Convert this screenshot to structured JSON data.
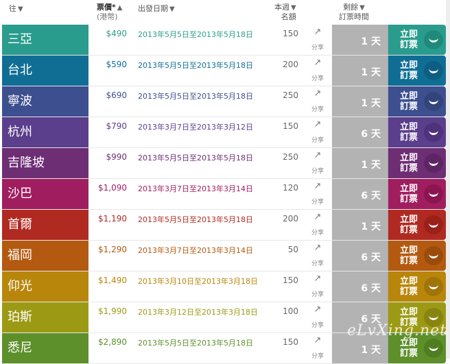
{
  "header": {
    "destination": "往",
    "price_line1": "票價*",
    "price_line2": "(港幣)",
    "date": "出發日期",
    "quota_line1": "本週",
    "quota_line2": "名額",
    "remain_line1": "剩餘",
    "remain_line2": "訂票時間",
    "sort_down": "▼",
    "sort_up": "▲"
  },
  "share_label": "分享",
  "share_icon": "↗",
  "book_label": "立即\n訂票",
  "watermark": "eLvXing.net",
  "rows": [
    {
      "dest": "三亞",
      "price": "$490",
      "date": "2013年5月5日至2013年5月18日",
      "quota": "150",
      "remain": "1 天",
      "color": "#2a9c8d",
      "btn": "#1f8a7a",
      "text_color": "#2a9c8d"
    },
    {
      "dest": "台北",
      "price": "$590",
      "date": "2013年5月5日至2013年5月18日",
      "quota": "200",
      "remain": "1 天",
      "color": "#106e95",
      "btn": "#0c5e82",
      "text_color": "#106e95"
    },
    {
      "dest": "寧波",
      "price": "$690",
      "date": "2013年5月5日至2013年5月18日",
      "quota": "250",
      "remain": "1 天",
      "color": "#3d4f8e",
      "btn": "#33447d",
      "text_color": "#3d4f8e"
    },
    {
      "dest": "杭州",
      "price": "$790",
      "date": "2013年3月7日至2013年3月12日",
      "quota": "150",
      "remain": "6 天",
      "color": "#5b3e8c",
      "btn": "#4f327c",
      "text_color": "#5b3e8c"
    },
    {
      "dest": "吉隆坡",
      "price": "$990",
      "date": "2013年5月5日至2013年5月18日",
      "quota": "250",
      "remain": "1 天",
      "color": "#6d2e74",
      "btn": "#5e2564",
      "text_color": "#6d2e74"
    },
    {
      "dest": "沙巴",
      "price": "$1,090",
      "date": "2013年3月7日至2013年3月14日",
      "quota": "120",
      "remain": "6 天",
      "color": "#a01e5f",
      "btn": "#8a1550",
      "text_color": "#a01e5f"
    },
    {
      "dest": "首爾",
      "price": "$1,190",
      "date": "2013年5月5日至2013年5月18日",
      "quota": "200",
      "remain": "1 天",
      "color": "#b02a22",
      "btn": "#9a211a",
      "text_color": "#b02a22"
    },
    {
      "dest": "福岡",
      "price": "$1,290",
      "date": "2013年3月7日至2013年3月14日",
      "quota": "50",
      "remain": "6 天",
      "color": "#b35a10",
      "btn": "#9b4c0a",
      "text_color": "#b35a10"
    },
    {
      "dest": "仰光",
      "price": "$1,490",
      "date": "2013年3月10日至2013年3月18日",
      "quota": "150",
      "remain": "6 天",
      "color": "#b8860b",
      "btn": "#a07408",
      "text_color": "#b8860b"
    },
    {
      "dest": "珀斯",
      "price": "$1,990",
      "date": "2013年3月12日至2013年3月18日",
      "quota": "100",
      "remain": "6 天",
      "color": "#9c9a14",
      "btn": "#87850f",
      "text_color": "#9c9a14"
    },
    {
      "dest": "悉尼",
      "price": "$2,890",
      "date": "2013年5月5日至2013年5月18日",
      "quota": "150",
      "remain": "1 天",
      "color": "#5d8f2a",
      "btn": "#4f7d20",
      "text_color": "#5d8f2a"
    }
  ]
}
